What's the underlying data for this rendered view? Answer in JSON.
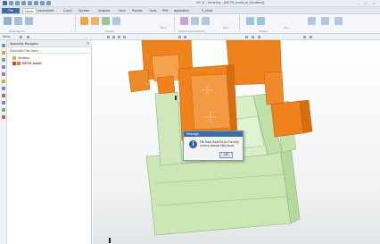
{
  "window": {
    "title": "NX 11 - Modeling - [MOTB_board.prt (Modified)]"
  },
  "menu": {
    "file": "File",
    "tabs": [
      "Home",
      "Assemblies",
      "Curve",
      "Surface",
      "Analysis",
      "View",
      "Render",
      "Tools",
      "PMI",
      "application",
      "S_Mold"
    ]
  },
  "ribbon": {
    "groups": [
      "Direct Sketch",
      "Feature",
      "Synchronous Modeling",
      "Surface"
    ],
    "more_label": "More"
  },
  "toolbar2": {
    "menu_label": "Menu"
  },
  "navigator": {
    "title": "Assembly Navigator",
    "column": "Descriptive Part Name",
    "items": [
      {
        "label": "Sections"
      },
      {
        "label": "MOTB_board"
      }
    ]
  },
  "dialog": {
    "title": "Message",
    "message": "File Save Save Errors For help on error choose Help Issue",
    "ok": "OK"
  },
  "colors": {
    "accent": "#3a6ea5",
    "part_orange": "#f0821e",
    "part_green": "#cbe7b4"
  }
}
